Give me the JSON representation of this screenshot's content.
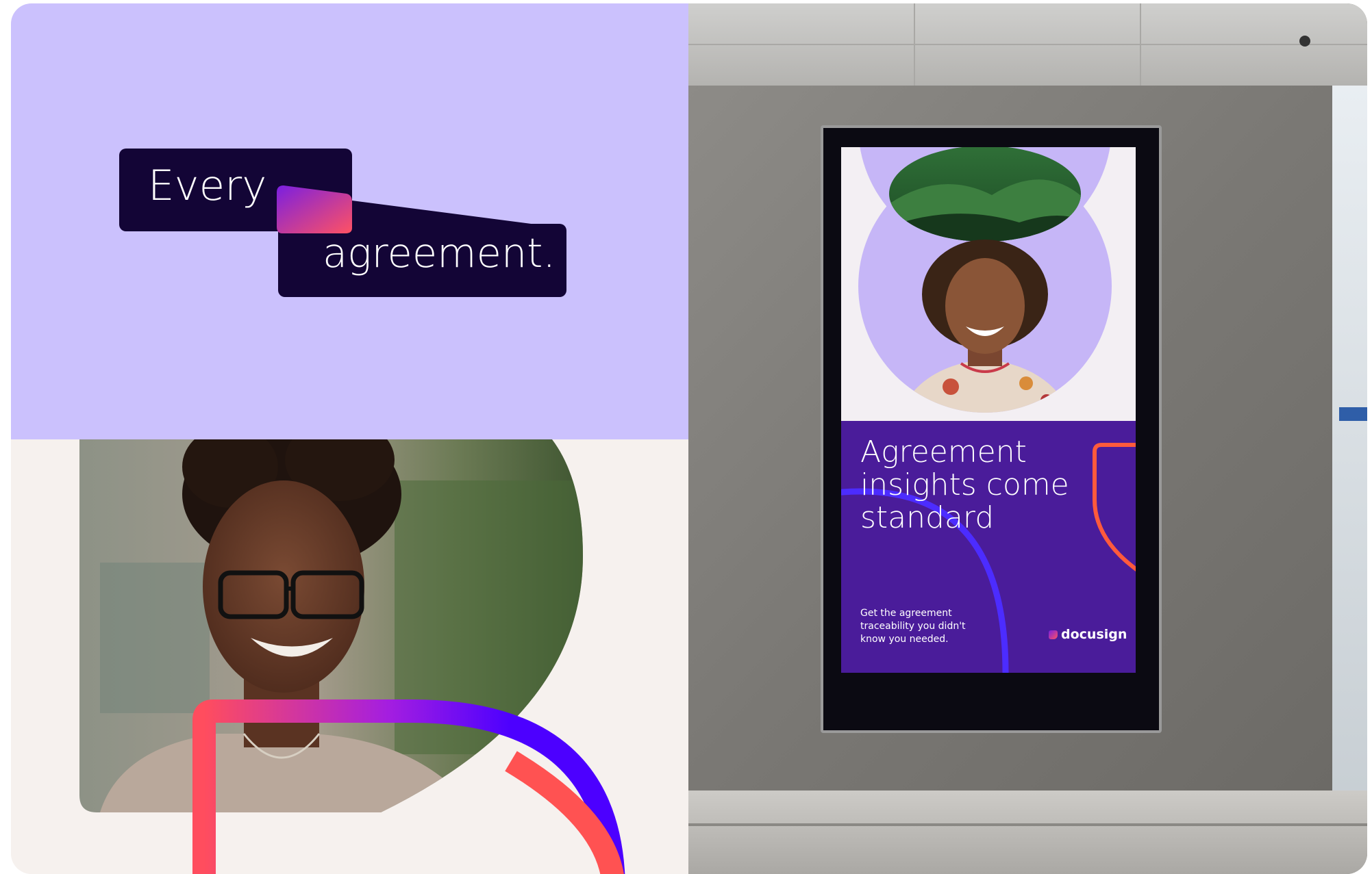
{
  "headline": {
    "line1": "Every",
    "line2": "agreement."
  },
  "billboard": {
    "headline": "Agreement\ninsights come\nstandard",
    "subtext": "Get the agreement\ntraceability you didn't\nknow you needed.",
    "brand": "docusign"
  },
  "colors": {
    "lavender": "#cbc1fd",
    "navy": "#130536",
    "purple": "#4a1c9a",
    "coral": "#ff5252",
    "violet": "#4c00ff",
    "cream": "#f6f1ee"
  },
  "images": {
    "woman_with_glasses": "smiling-woman-photo",
    "woman_poster": "smiling-woman-poster-photo",
    "mountains": "green-mountains-photo"
  }
}
